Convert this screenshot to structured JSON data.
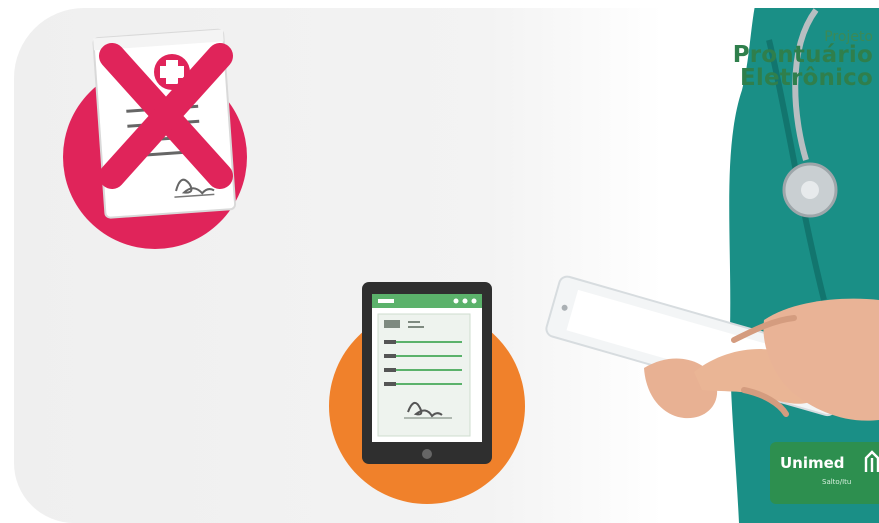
{
  "title": {
    "kicker": "Projeto",
    "line1": "Prontuário",
    "line2": "Eletrônico"
  },
  "logo": {
    "name": "Unimed",
    "subtitle": "Salto/Itu"
  },
  "colors": {
    "pink": "#e0245a",
    "orange": "#f0812b",
    "scrubs": "#1a8f86",
    "green_brand": "#2d8f4f",
    "tablet_bar": "#5bb26b"
  },
  "icons": [
    "paper-record-icon",
    "cross-mark-icon",
    "tablet-record-icon",
    "stethoscope-icon",
    "unimed-logo-mark-icon"
  ]
}
